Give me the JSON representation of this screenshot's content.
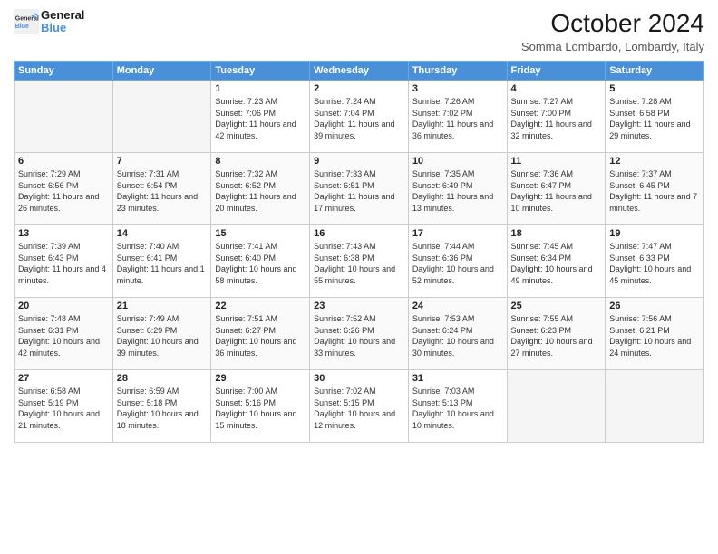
{
  "header": {
    "logo_line1": "General",
    "logo_line2": "Blue",
    "month": "October 2024",
    "location": "Somma Lombardo, Lombardy, Italy"
  },
  "weekdays": [
    "Sunday",
    "Monday",
    "Tuesday",
    "Wednesday",
    "Thursday",
    "Friday",
    "Saturday"
  ],
  "weeks": [
    [
      {
        "day": "",
        "empty": true
      },
      {
        "day": "",
        "empty": true
      },
      {
        "day": "1",
        "sunrise": "Sunrise: 7:23 AM",
        "sunset": "Sunset: 7:06 PM",
        "daylight": "Daylight: 11 hours and 42 minutes."
      },
      {
        "day": "2",
        "sunrise": "Sunrise: 7:24 AM",
        "sunset": "Sunset: 7:04 PM",
        "daylight": "Daylight: 11 hours and 39 minutes."
      },
      {
        "day": "3",
        "sunrise": "Sunrise: 7:26 AM",
        "sunset": "Sunset: 7:02 PM",
        "daylight": "Daylight: 11 hours and 36 minutes."
      },
      {
        "day": "4",
        "sunrise": "Sunrise: 7:27 AM",
        "sunset": "Sunset: 7:00 PM",
        "daylight": "Daylight: 11 hours and 32 minutes."
      },
      {
        "day": "5",
        "sunrise": "Sunrise: 7:28 AM",
        "sunset": "Sunset: 6:58 PM",
        "daylight": "Daylight: 11 hours and 29 minutes."
      }
    ],
    [
      {
        "day": "6",
        "sunrise": "Sunrise: 7:29 AM",
        "sunset": "Sunset: 6:56 PM",
        "daylight": "Daylight: 11 hours and 26 minutes."
      },
      {
        "day": "7",
        "sunrise": "Sunrise: 7:31 AM",
        "sunset": "Sunset: 6:54 PM",
        "daylight": "Daylight: 11 hours and 23 minutes."
      },
      {
        "day": "8",
        "sunrise": "Sunrise: 7:32 AM",
        "sunset": "Sunset: 6:52 PM",
        "daylight": "Daylight: 11 hours and 20 minutes."
      },
      {
        "day": "9",
        "sunrise": "Sunrise: 7:33 AM",
        "sunset": "Sunset: 6:51 PM",
        "daylight": "Daylight: 11 hours and 17 minutes."
      },
      {
        "day": "10",
        "sunrise": "Sunrise: 7:35 AM",
        "sunset": "Sunset: 6:49 PM",
        "daylight": "Daylight: 11 hours and 13 minutes."
      },
      {
        "day": "11",
        "sunrise": "Sunrise: 7:36 AM",
        "sunset": "Sunset: 6:47 PM",
        "daylight": "Daylight: 11 hours and 10 minutes."
      },
      {
        "day": "12",
        "sunrise": "Sunrise: 7:37 AM",
        "sunset": "Sunset: 6:45 PM",
        "daylight": "Daylight: 11 hours and 7 minutes."
      }
    ],
    [
      {
        "day": "13",
        "sunrise": "Sunrise: 7:39 AM",
        "sunset": "Sunset: 6:43 PM",
        "daylight": "Daylight: 11 hours and 4 minutes."
      },
      {
        "day": "14",
        "sunrise": "Sunrise: 7:40 AM",
        "sunset": "Sunset: 6:41 PM",
        "daylight": "Daylight: 11 hours and 1 minute."
      },
      {
        "day": "15",
        "sunrise": "Sunrise: 7:41 AM",
        "sunset": "Sunset: 6:40 PM",
        "daylight": "Daylight: 10 hours and 58 minutes."
      },
      {
        "day": "16",
        "sunrise": "Sunrise: 7:43 AM",
        "sunset": "Sunset: 6:38 PM",
        "daylight": "Daylight: 10 hours and 55 minutes."
      },
      {
        "day": "17",
        "sunrise": "Sunrise: 7:44 AM",
        "sunset": "Sunset: 6:36 PM",
        "daylight": "Daylight: 10 hours and 52 minutes."
      },
      {
        "day": "18",
        "sunrise": "Sunrise: 7:45 AM",
        "sunset": "Sunset: 6:34 PM",
        "daylight": "Daylight: 10 hours and 49 minutes."
      },
      {
        "day": "19",
        "sunrise": "Sunrise: 7:47 AM",
        "sunset": "Sunset: 6:33 PM",
        "daylight": "Daylight: 10 hours and 45 minutes."
      }
    ],
    [
      {
        "day": "20",
        "sunrise": "Sunrise: 7:48 AM",
        "sunset": "Sunset: 6:31 PM",
        "daylight": "Daylight: 10 hours and 42 minutes."
      },
      {
        "day": "21",
        "sunrise": "Sunrise: 7:49 AM",
        "sunset": "Sunset: 6:29 PM",
        "daylight": "Daylight: 10 hours and 39 minutes."
      },
      {
        "day": "22",
        "sunrise": "Sunrise: 7:51 AM",
        "sunset": "Sunset: 6:27 PM",
        "daylight": "Daylight: 10 hours and 36 minutes."
      },
      {
        "day": "23",
        "sunrise": "Sunrise: 7:52 AM",
        "sunset": "Sunset: 6:26 PM",
        "daylight": "Daylight: 10 hours and 33 minutes."
      },
      {
        "day": "24",
        "sunrise": "Sunrise: 7:53 AM",
        "sunset": "Sunset: 6:24 PM",
        "daylight": "Daylight: 10 hours and 30 minutes."
      },
      {
        "day": "25",
        "sunrise": "Sunrise: 7:55 AM",
        "sunset": "Sunset: 6:23 PM",
        "daylight": "Daylight: 10 hours and 27 minutes."
      },
      {
        "day": "26",
        "sunrise": "Sunrise: 7:56 AM",
        "sunset": "Sunset: 6:21 PM",
        "daylight": "Daylight: 10 hours and 24 minutes."
      }
    ],
    [
      {
        "day": "27",
        "sunrise": "Sunrise: 6:58 AM",
        "sunset": "Sunset: 5:19 PM",
        "daylight": "Daylight: 10 hours and 21 minutes."
      },
      {
        "day": "28",
        "sunrise": "Sunrise: 6:59 AM",
        "sunset": "Sunset: 5:18 PM",
        "daylight": "Daylight: 10 hours and 18 minutes."
      },
      {
        "day": "29",
        "sunrise": "Sunrise: 7:00 AM",
        "sunset": "Sunset: 5:16 PM",
        "daylight": "Daylight: 10 hours and 15 minutes."
      },
      {
        "day": "30",
        "sunrise": "Sunrise: 7:02 AM",
        "sunset": "Sunset: 5:15 PM",
        "daylight": "Daylight: 10 hours and 12 minutes."
      },
      {
        "day": "31",
        "sunrise": "Sunrise: 7:03 AM",
        "sunset": "Sunset: 5:13 PM",
        "daylight": "Daylight: 10 hours and 10 minutes."
      },
      {
        "day": "",
        "empty": true
      },
      {
        "day": "",
        "empty": true
      }
    ]
  ]
}
